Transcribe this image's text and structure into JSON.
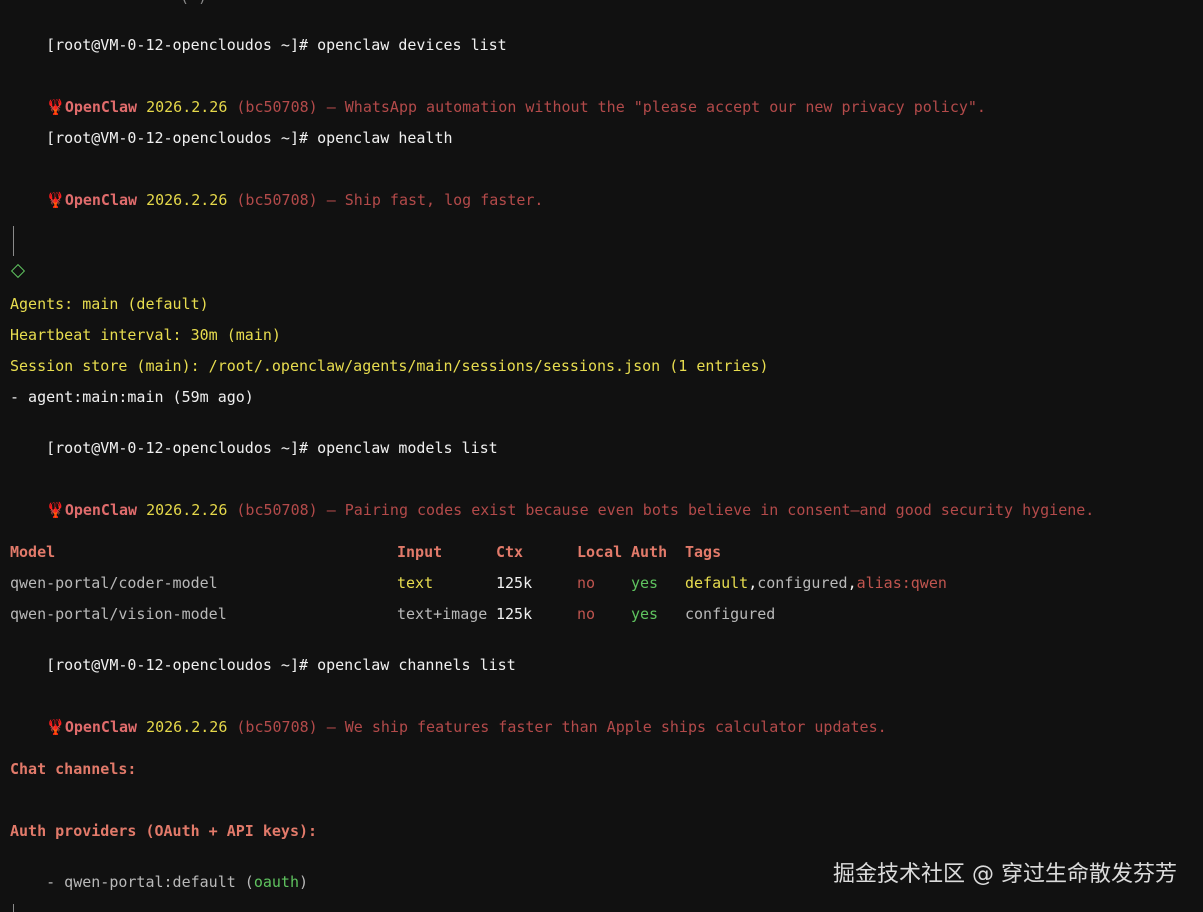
{
  "prompt": "[root@VM-0-12-opencloudos ~]#",
  "banner": {
    "icon": "lobster-icon",
    "name": "OpenClaw",
    "version": "2026.2.26",
    "build": "(bc50708)"
  },
  "commands": {
    "devices": "openclaw devices list",
    "health": "openclaw health",
    "models": "openclaw models list",
    "channels": "openclaw channels list"
  },
  "taglines": {
    "t1": "— WhatsApp automation without the \"please accept our new privacy policy\".",
    "t2": "— Ship fast, log faster.",
    "t3": "— Pairing codes exist because even bots believe in consent—and good security hygiene.",
    "t4": "— We ship features faster than Apple ships calculator updates."
  },
  "health": {
    "agents": "Agents: main (default)",
    "heartbeat": "Heartbeat interval: 30m (main)",
    "session_store": "Session store (main): /root/.openclaw/agents/main/sessions/sessions.json (1 entries)",
    "agent_entry": "- agent:main:main (59m ago)"
  },
  "models_table": {
    "headers": {
      "model": "Model",
      "input": "Input",
      "ctx": "Ctx",
      "local": "Local",
      "auth": "Auth",
      "tags": "Tags"
    },
    "rows": [
      {
        "model": "qwen-portal/coder-model",
        "input": "text",
        "ctx": "125k",
        "local": "no",
        "auth": "yes",
        "tags_a": "default",
        "tags_sep1": ",",
        "tags_b": "configured",
        "tags_sep2": ",",
        "tags_c": "alias:qwen"
      },
      {
        "model": "qwen-portal/vision-model",
        "input": "text+image",
        "ctx": "125k",
        "local": "no",
        "auth": "yes",
        "tags_a": "configured"
      }
    ]
  },
  "channels": {
    "chat_header": "Chat channels:",
    "auth_header": "Auth providers (OAuth + API keys):",
    "provider_prefix": "- qwen-portal:default (",
    "provider_type": "oauth",
    "provider_suffix": ")"
  },
  "watermark": "掘金技术社区 @ 穿过生命散发芬芳",
  "colors": {
    "background": "#111111",
    "banner_name": "#e06c6c",
    "version": "#e5d84a",
    "tagline": "#b34a4a",
    "yellow_text": "#e8dd4f",
    "green": "#5fc35f",
    "table_header": "#e27a6a"
  }
}
